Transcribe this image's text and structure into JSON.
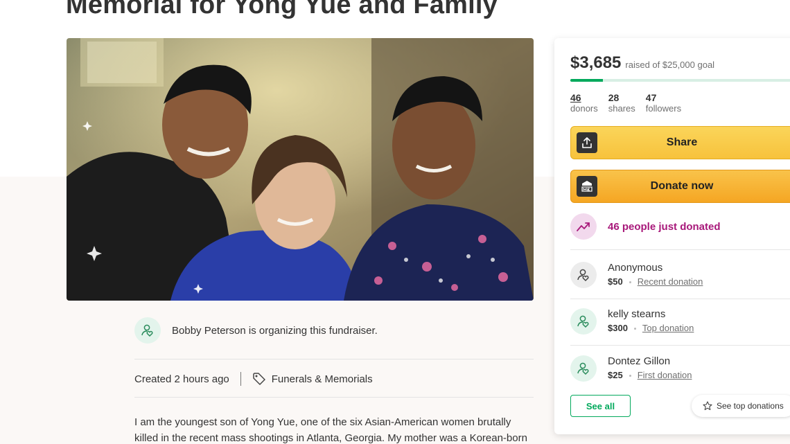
{
  "page": {
    "title": "Memorial for Yong Yue and Family"
  },
  "organizer": {
    "text": "Bobby Peterson is organizing this fundraiser."
  },
  "meta": {
    "created": "Created 2 hours ago",
    "category": "Funerals & Memorials"
  },
  "story": {
    "line1": "I am the youngest son of Yong Yue, one of the six Asian-American women brutally",
    "line2": "killed in the recent mass shootings in Atlanta, Georgia. My mother was a Korean-born"
  },
  "card": {
    "raised": "$3,685",
    "goal_text": "raised of $25,000 goal",
    "progress_fraction": 0.147,
    "stats": [
      {
        "num": "46",
        "label": "donors"
      },
      {
        "num": "28",
        "label": "shares"
      },
      {
        "num": "47",
        "label": "followers"
      }
    ],
    "share_label": "Share",
    "donate_label": "Donate now",
    "trend_text": "46 people just donated",
    "donations": [
      {
        "name": "Anonymous",
        "amount": "$50",
        "kind": "Recent donation"
      },
      {
        "name": "kelly stearns",
        "amount": "$300",
        "kind": "Top donation"
      },
      {
        "name": "Dontez Gillon",
        "amount": "$25",
        "kind": "First donation"
      }
    ],
    "see_all_label": "See all",
    "see_top_label": "See top donations"
  },
  "colors": {
    "brand_green": "#02a95c",
    "share_button": "#f7c23c",
    "donate_button": "#f5a623",
    "trend_magenta": "#a8187a"
  },
  "icons": {
    "organizer": "person-heart-icon",
    "category": "tag-icon",
    "share": "share-upload-icon",
    "donate": "gofundme-logo-icon",
    "trend": "trending-up-icon",
    "donor": "person-heart-icon",
    "see_top": "star-icon"
  }
}
